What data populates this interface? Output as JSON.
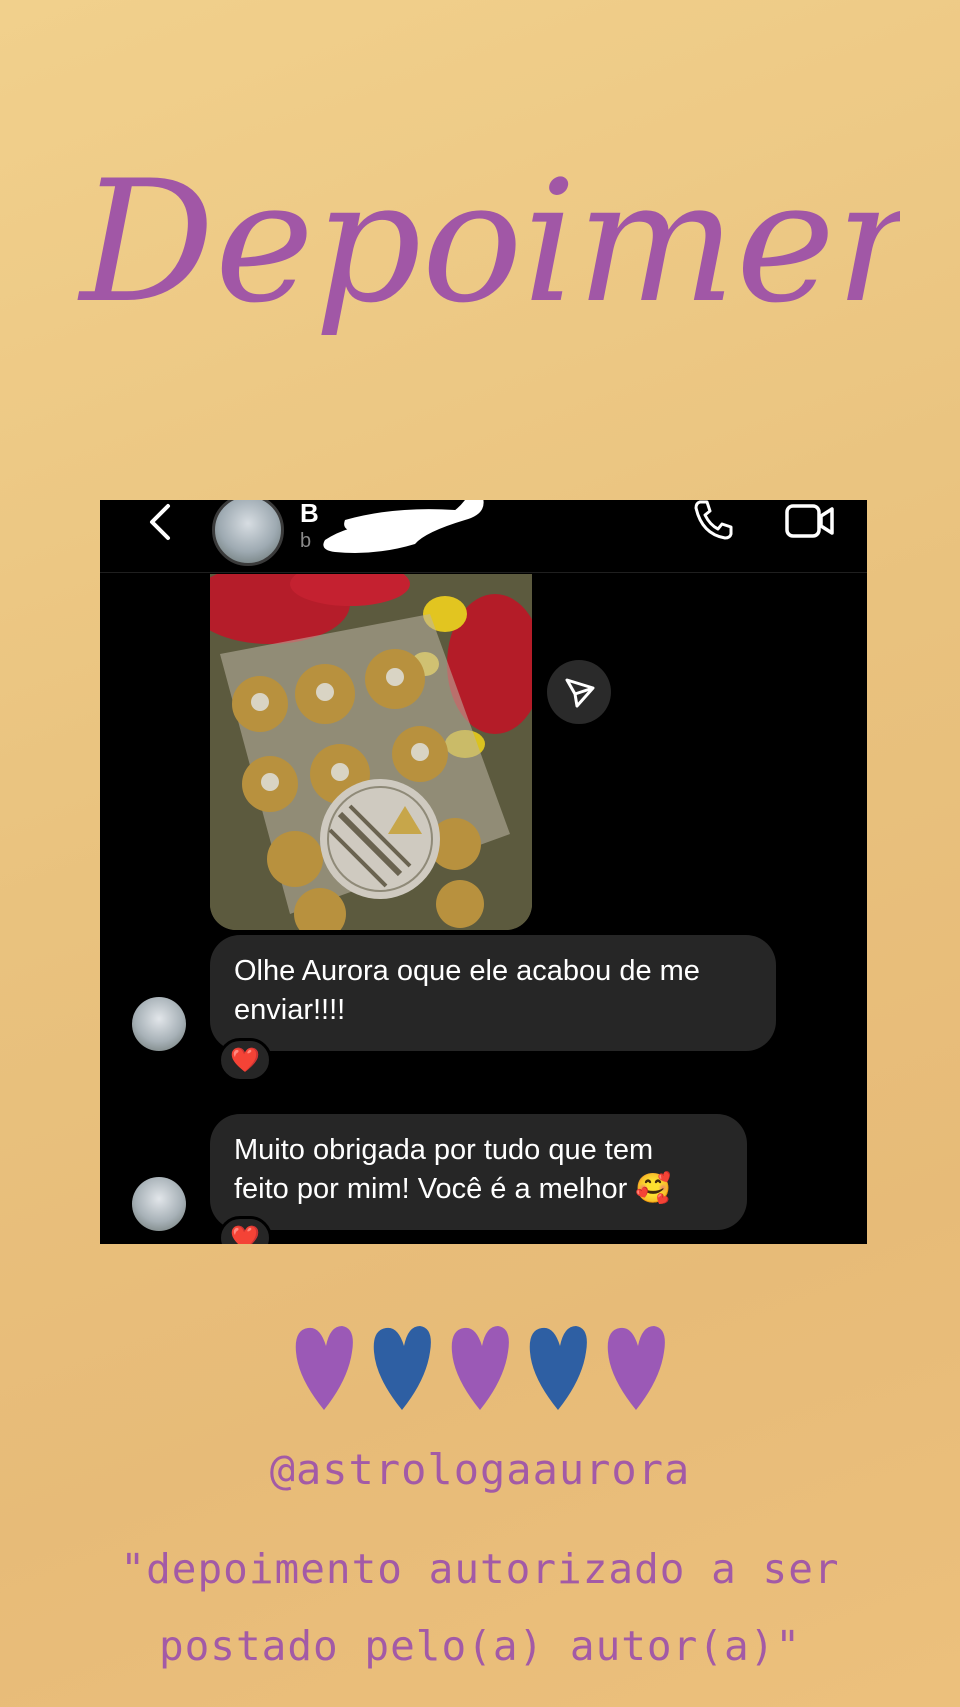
{
  "title": "Depoimentos",
  "chat": {
    "header": {
      "name_visible": "B",
      "subtitle_visible": "b"
    },
    "icons": [
      "chevron-left-icon",
      "phone-icon",
      "video-camera-icon",
      "paper-plane-icon"
    ],
    "messages": [
      {
        "lines": [
          "Olhe Aurora oque ele acabou de me",
          "enviar!!!!"
        ],
        "reaction": "❤️"
      },
      {
        "lines": [
          "Muito obrigada por tudo que tem",
          "feito por mim! Você é a melhor 🥰"
        ],
        "reaction": "❤️"
      }
    ]
  },
  "hearts": [
    "#9b59b6",
    "#2e5fa3",
    "#9b59b6",
    "#2e5fa3",
    "#9b59b6"
  ],
  "footer": {
    "handle": "@astrologaaurora",
    "note_line1": "\"depoimento autorizado a ser",
    "note_line2": "postado pelo(a) autor(a)\""
  },
  "colors": {
    "accent_purple": "#a157a6",
    "accent_blue": "#2e5fa3",
    "chat_bg": "#000000",
    "bubble_bg": "#262626"
  }
}
